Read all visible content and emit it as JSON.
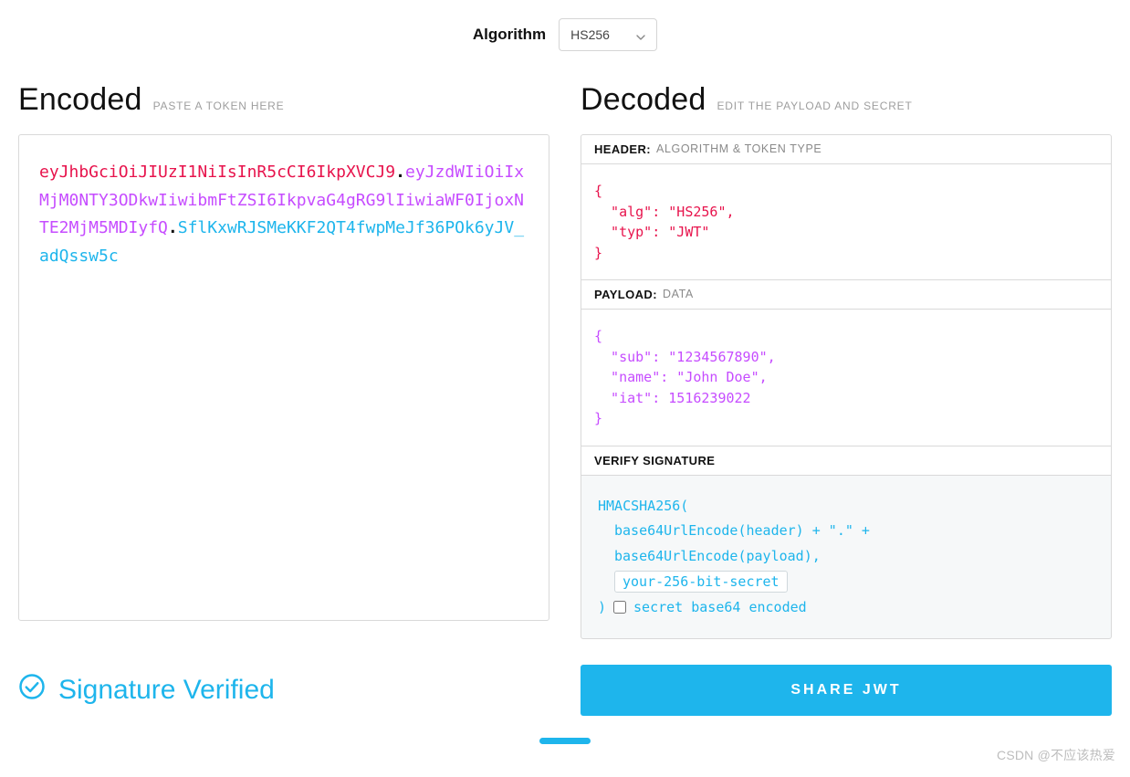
{
  "algorithm": {
    "label": "Algorithm",
    "value": "HS256"
  },
  "encoded": {
    "title": "Encoded",
    "subtitle": "PASTE A TOKEN HERE",
    "token": {
      "header": "eyJhbGciOiJIUzI1NiIsInR5cCI6IkpXVCJ9",
      "payload": "eyJzdWIiOiIxMjM0NTY3ODkwIiwibmFtZSI6IkpvaG4gRG9lIiwiaWF0IjoxNTE2MjM5MDIyfQ",
      "signature": "SflKxwRJSMeKKF2QT4fwpMeJf36POk6yJV_adQssw5c"
    }
  },
  "decoded": {
    "title": "Decoded",
    "subtitle": "EDIT THE PAYLOAD AND SECRET",
    "header": {
      "label": "HEADER:",
      "sub": "ALGORITHM & TOKEN TYPE",
      "body": "{\n  \"alg\": \"HS256\",\n  \"typ\": \"JWT\"\n}"
    },
    "payload": {
      "label": "PAYLOAD:",
      "sub": "DATA",
      "body": "{\n  \"sub\": \"1234567890\",\n  \"name\": \"John Doe\",\n  \"iat\": 1516239022\n}"
    },
    "signature": {
      "label": "VERIFY SIGNATURE",
      "line1": "HMACSHA256(",
      "line2": "base64UrlEncode(header) + \".\" +",
      "line3": "base64UrlEncode(payload),",
      "secret_value": "your-256-bit-secret",
      "close_paren": ")",
      "checkbox_label": "secret base64 encoded"
    }
  },
  "status": {
    "verified_text": "Signature Verified",
    "share_button": "SHARE JWT"
  },
  "watermark": "CSDN @不应该热爱"
}
